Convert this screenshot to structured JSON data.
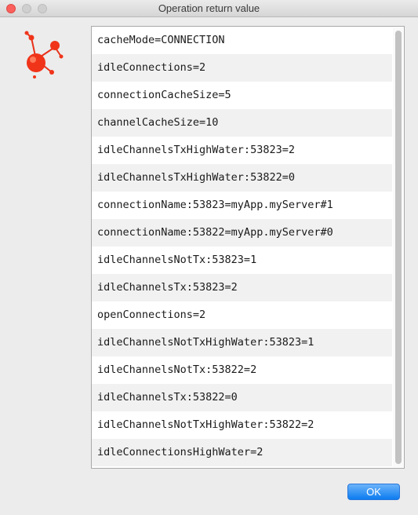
{
  "window": {
    "title": "Operation return value"
  },
  "list": {
    "items": [
      "cacheMode=CONNECTION",
      "idleConnections=2",
      "connectionCacheSize=5",
      "channelCacheSize=10",
      "idleChannelsTxHighWater:53823=2",
      "idleChannelsTxHighWater:53822=0",
      "connectionName:53823=myApp.myServer#1",
      "connectionName:53822=myApp.myServer#0",
      "idleChannelsNotTx:53823=1",
      "idleChannelsTx:53823=2",
      "openConnections=2",
      "idleChannelsNotTxHighWater:53823=1",
      "idleChannelsNotTx:53822=2",
      "idleChannelsTx:53822=0",
      "idleChannelsNotTxHighWater:53822=2",
      "idleConnectionsHighWater=2"
    ]
  },
  "buttons": {
    "ok_label": "OK"
  },
  "colors": {
    "accent": "#0c7cf0",
    "app_icon": "#f0341a",
    "close_button": "#fc605c"
  },
  "icons": {
    "app": "molecule-icon"
  }
}
